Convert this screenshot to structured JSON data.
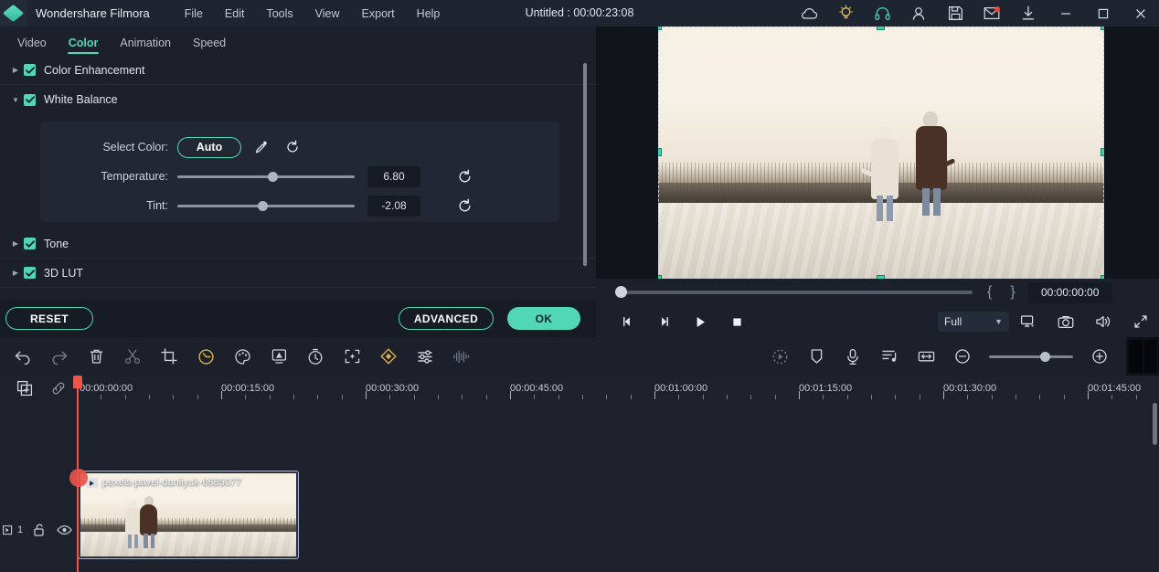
{
  "titlebar": {
    "app_name": "Wondershare Filmora",
    "project_title": "Untitled : 00:00:23:08",
    "menus": [
      "File",
      "Edit",
      "Tools",
      "View",
      "Export",
      "Help"
    ],
    "icons": [
      {
        "name": "cloud-icon",
        "label": "Cloud"
      },
      {
        "name": "lightbulb-icon",
        "label": "Tips"
      },
      {
        "name": "headphones-icon",
        "label": "Support"
      },
      {
        "name": "account-icon",
        "label": "Account"
      },
      {
        "name": "save-icon",
        "label": "Save"
      },
      {
        "name": "mail-icon",
        "label": "Messages"
      },
      {
        "name": "download-icon",
        "label": "Downloads"
      }
    ],
    "window_buttons": [
      "minimize",
      "maximize",
      "close"
    ]
  },
  "left_panel": {
    "tabs": [
      {
        "label": "Video",
        "active": false
      },
      {
        "label": "Color",
        "active": true
      },
      {
        "label": "Animation",
        "active": false
      },
      {
        "label": "Speed",
        "active": false
      }
    ],
    "sections": [
      {
        "label": "Color Enhancement",
        "expanded": false,
        "checked": true
      },
      {
        "label": "White Balance",
        "expanded": true,
        "checked": true
      },
      {
        "label": "Tone",
        "expanded": false,
        "checked": true
      },
      {
        "label": "3D LUT",
        "expanded": false,
        "checked": true
      }
    ],
    "white_balance": {
      "select_color_label": "Select Color:",
      "auto_button": "Auto",
      "eyedropper_icon": "eyedropper-icon",
      "reset_icon": "reset-icon",
      "temperature": {
        "label": "Temperature:",
        "value": "6.80",
        "knob_percent": 53
      },
      "tint": {
        "label": "Tint:",
        "value": "-2.08",
        "knob_percent": 47
      }
    },
    "footer": {
      "reset": "RESET",
      "advanced": "ADVANCED",
      "ok": "OK"
    }
  },
  "player": {
    "timecode": "00:00:00:00",
    "mark_in": "{",
    "mark_out": "}",
    "quality": "Full",
    "scrub_percent": 0,
    "controls": [
      {
        "name": "prev-frame-button"
      },
      {
        "name": "next-frame-button"
      },
      {
        "name": "play-button"
      },
      {
        "name": "stop-button"
      }
    ],
    "right_controls": [
      {
        "name": "display-mode-icon"
      },
      {
        "name": "snapshot-icon"
      },
      {
        "name": "volume-icon"
      },
      {
        "name": "fullscreen-icon"
      }
    ]
  },
  "toolbar": {
    "left_tools": [
      {
        "name": "undo-icon",
        "label": "Undo"
      },
      {
        "name": "redo-icon",
        "label": "Redo"
      },
      {
        "name": "delete-icon",
        "label": "Delete"
      },
      {
        "name": "split-icon",
        "label": "Split"
      },
      {
        "name": "crop-icon",
        "label": "Crop"
      },
      {
        "name": "speed-icon",
        "label": "Speed"
      },
      {
        "name": "color-palette-icon",
        "label": "Color"
      },
      {
        "name": "green-screen-icon",
        "label": "Green Screen"
      },
      {
        "name": "freeze-frame-icon",
        "label": "Freeze Frame"
      },
      {
        "name": "auto-reframe-icon",
        "label": "Auto Reframe"
      },
      {
        "name": "keyframe-icon",
        "label": "Keyframe"
      },
      {
        "name": "adjust-icon",
        "label": "Adjust"
      },
      {
        "name": "audio-detach-icon",
        "label": "Audio"
      }
    ],
    "right_tools": [
      {
        "name": "render-preview-icon",
        "label": "Render Preview"
      },
      {
        "name": "marker-icon",
        "label": "Marker"
      },
      {
        "name": "voiceover-icon",
        "label": "Record Voiceover"
      },
      {
        "name": "audio-mixer-icon",
        "label": "Audio Mixer"
      },
      {
        "name": "fit-timeline-icon",
        "label": "Zoom to Fit"
      },
      {
        "name": "zoom-out-icon",
        "label": "Zoom Out"
      },
      {
        "name": "zoom-in-icon",
        "label": "Zoom In"
      }
    ],
    "zoom_percent": 60
  },
  "timeline": {
    "header_icons": [
      {
        "name": "import-media-icon",
        "label": "Add Media"
      },
      {
        "name": "link-icon",
        "label": "Link"
      }
    ],
    "ruler_labels": [
      "00:00:00:00",
      "00:00:15:00",
      "00:00:30:00",
      "00:00:45:00",
      "00:01:00:00",
      "00:01:15:00",
      "00:01:30:00",
      "00:01:45:00"
    ],
    "track": {
      "number": "1",
      "lock_icon": "unlock-icon",
      "eye_icon": "eye-icon"
    },
    "clip": {
      "name": "pexels-pavel-daniiyuk-6685077"
    }
  },
  "colors": {
    "accent": "#51d7b3",
    "playhead": "#f2534a",
    "panel_bg": "#1b202a",
    "timeline_bg": "#1c212b",
    "titlebar_bg": "#1e2430",
    "selection_handle": "#3fd0ad"
  }
}
